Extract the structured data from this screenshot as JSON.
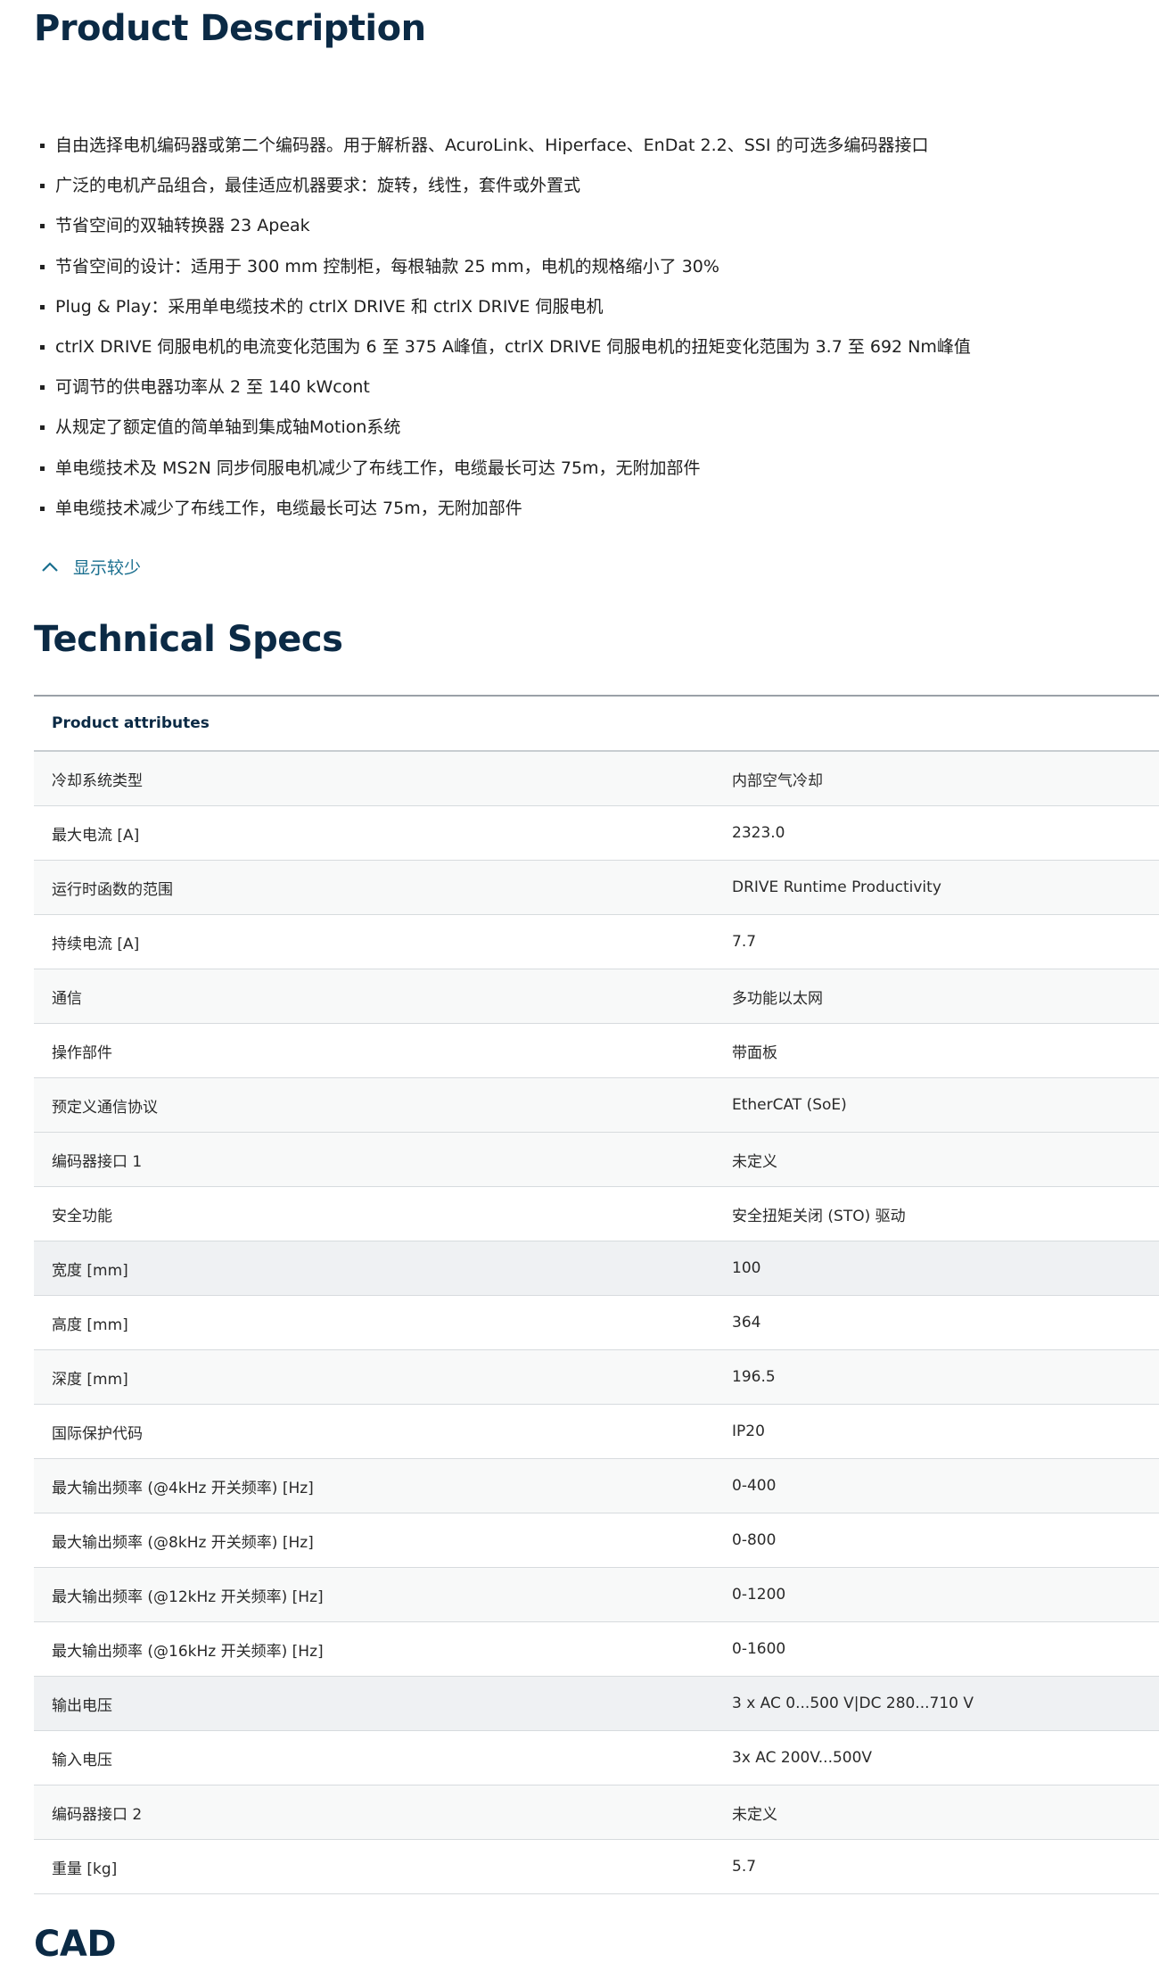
{
  "description": {
    "title": "Product Description",
    "bullets": [
      "自由选择电机编码器或第二个编码器。用于解析器、AcuroLink、Hiperface、EnDat 2.2、SSI 的可选多编码器接口",
      "广泛的电机产品组合，最佳适应机器要求：旋转，线性，套件或外置式",
      "节省空间的双轴转换器 23 Apeak",
      "节省空间的设计：适用于 300 mm 控制柜，每根轴款 25 mm，电机的规格缩小了 30%",
      "Plug & Play：采用单电缆技术的 ctrlX DRIVE 和 ctrlX DRIVE 伺服电机",
      "ctrlX DRIVE 伺服电机的电流变化范围为 6 至 375 A峰值，ctrlX DRIVE 伺服电机的扭矩变化范围为 3.7 至 692 Nm峰值",
      "可调节的供电器功率从 2 至 140 kWcont",
      "从规定了额定值的简单轴到集成轴Motion系统",
      "单电缆技术及 MS2N 同步伺服电机减少了布线工作，电缆最长可达 75m，无附加部件",
      "单电缆技术减少了布线工作，电缆最长可达 75m，无附加部件"
    ],
    "show_less_label": "显示较少"
  },
  "specs": {
    "title": "Technical Specs",
    "header": "Product attributes",
    "rows": [
      {
        "attr": "冷却系统类型",
        "value": "内部空气冷却"
      },
      {
        "attr": "最大电流 [A]",
        "value": "2323.0"
      },
      {
        "attr": "运行时函数的范围",
        "value": "DRIVE Runtime Productivity"
      },
      {
        "attr": "持续电流 [A]",
        "value": "7.7"
      },
      {
        "attr": "通信",
        "value": "多功能以太网"
      },
      {
        "attr": "操作部件",
        "value": "带面板"
      },
      {
        "attr": "预定义通信协议",
        "value": "EtherCAT (SoE)"
      },
      {
        "attr": "编码器接口 1",
        "value": "未定义"
      },
      {
        "attr": "安全功能",
        "value": "安全扭矩关闭 (STO) 驱动"
      },
      {
        "attr": "宽度 [mm]",
        "value": "100"
      },
      {
        "attr": "高度 [mm]",
        "value": "364"
      },
      {
        "attr": "深度 [mm]",
        "value": "196.5"
      },
      {
        "attr": "国际保护代码",
        "value": "IP20"
      },
      {
        "attr": "最大输出频率 (@4kHz 开关频率) [Hz]",
        "value": "0-400"
      },
      {
        "attr": "最大输出频率 (@8kHz 开关频率) [Hz]",
        "value": "0-800"
      },
      {
        "attr": "最大输出频率 (@12kHz 开关频率) [Hz]",
        "value": "0-1200"
      },
      {
        "attr": "最大输出频率 (@16kHz 开关频率) [Hz]",
        "value": "0-1600"
      },
      {
        "attr": "输出电压",
        "value": "3 x AC 0...500 V|DC 280...710 V"
      },
      {
        "attr": "输入电压",
        "value": "3x AC 200V...500V"
      },
      {
        "attr": "编码器接口 2",
        "value": "未定义"
      },
      {
        "attr": "重量 [kg]",
        "value": "5.7"
      }
    ]
  },
  "cad": {
    "title": "CAD"
  },
  "colors": {
    "heading": "#0b2a45",
    "link": "#1a6f8f",
    "row_highlight": "#eff1f3"
  },
  "icons": {
    "show_less": "chevron-up-icon"
  }
}
